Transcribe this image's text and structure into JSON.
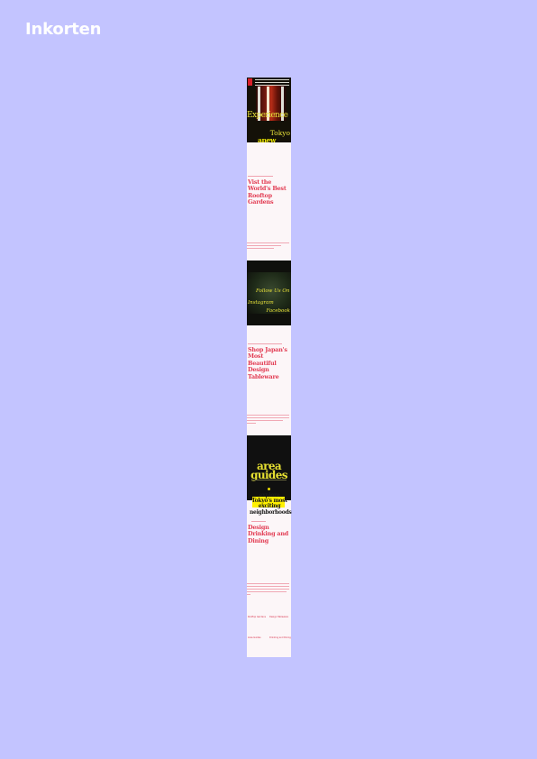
{
  "page": {
    "title": "Inkorten",
    "background_color": "#c3c4ff",
    "accent_color": "#e23b52",
    "highlight_color": "#e8e23a"
  },
  "strip": {
    "hero1": {
      "title": "Experience",
      "city": "Tokyo",
      "now": "anew"
    },
    "section1": {
      "headline": "Vist the World's Best Rooftop Gardens"
    },
    "hero2": {
      "line1": "Follow Us On",
      "line2": "Instagram",
      "line3": "Facebook"
    },
    "section2": {
      "headline": "Shop Japan's Most Beautiful Design Tableware"
    },
    "hero3": {
      "line1": "area",
      "line2": "guides",
      "explore": "explore Tokyo's most exciting neighborhoods"
    },
    "section3": {
      "headline": "Design Drinking and Dining"
    },
    "links": [
      "Rooftop Gardens",
      "Design Tableware",
      "Area Guides",
      "Drinking and Dining"
    ]
  }
}
